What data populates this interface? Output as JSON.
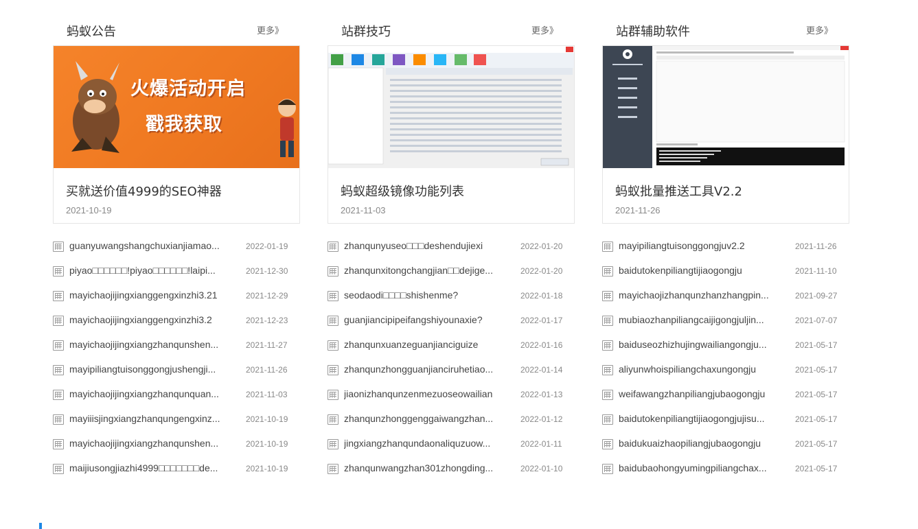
{
  "columns": [
    {
      "title": "蚂蚁公告",
      "more": "更多》",
      "feature": {
        "title": "买就送价值4999的SEO神器",
        "date": "2021-10-19",
        "image": {
          "line1": "火爆活动开启",
          "line2": "戳我获取"
        }
      },
      "items": [
        {
          "text": "guanyuwangshangchuxianjiamao...",
          "date": "2022-01-19"
        },
        {
          "text": "piyao□□□□□□!piyao□□□□□□!laipi...",
          "date": "2021-12-30"
        },
        {
          "text": "mayichaojijingxianggengxinzhi3.21",
          "date": "2021-12-29"
        },
        {
          "text": "mayichaojijingxianggengxinzhi3.2",
          "date": "2021-12-23"
        },
        {
          "text": "mayichaojijingxiangzhanqunshen...",
          "date": "2021-11-27"
        },
        {
          "text": "mayipiliangtuisonggongjushengji...",
          "date": "2021-11-26"
        },
        {
          "text": "mayichaojijingxiangzhanqunquan...",
          "date": "2021-11-03"
        },
        {
          "text": "mayiiisjingxiangzhanqungengxinz...",
          "date": "2021-10-19"
        },
        {
          "text": "mayichaojijingxiangzhanqunshen...",
          "date": "2021-10-19"
        },
        {
          "text": "maijiusongjiazhi4999□□□□□□□de...",
          "date": "2021-10-19"
        }
      ]
    },
    {
      "title": "站群技巧",
      "more": "更多》",
      "feature": {
        "title": "蚂蚁超级镜像功能列表",
        "date": "2021-11-03"
      },
      "items": [
        {
          "text": "zhanqunyuseo□□□deshendujiexi",
          "date": "2022-01-20"
        },
        {
          "text": "zhanqunxitongchangjian□□dejige...",
          "date": "2022-01-20"
        },
        {
          "text": "seodaodi□□□□shishenme?",
          "date": "2022-01-18"
        },
        {
          "text": "guanjiancipipeifangshiyounaxie?",
          "date": "2022-01-17"
        },
        {
          "text": "zhanqunxuanzeguanjianciguize",
          "date": "2022-01-16"
        },
        {
          "text": "zhanqunzhongguanjianciruhetiao...",
          "date": "2022-01-14"
        },
        {
          "text": "jiaonizhanqunzenmezuoseowailian",
          "date": "2022-01-13"
        },
        {
          "text": "zhanqunzhonggenggaiwangzhan...",
          "date": "2022-01-12"
        },
        {
          "text": "jingxiangzhanqundaonaliquzuow...",
          "date": "2022-01-11"
        },
        {
          "text": "zhanqunwangzhan301zhongding...",
          "date": "2022-01-10"
        }
      ]
    },
    {
      "title": "站群辅助软件",
      "more": "更多》",
      "feature": {
        "title": "蚂蚁批量推送工具V2.2",
        "date": "2021-11-26"
      },
      "items": [
        {
          "text": "mayipiliangtuisonggongjuv2.2",
          "date": "2021-11-26"
        },
        {
          "text": "baidutokenpiliangtijiaogongju",
          "date": "2021-11-10"
        },
        {
          "text": "mayichaojizhanqunzhanzhangpin...",
          "date": "2021-09-27"
        },
        {
          "text": "mubiaozhanpiliangcaijigongjuljin...",
          "date": "2021-07-07"
        },
        {
          "text": "baiduseozhizhujingwailiangongju...",
          "date": "2021-05-17"
        },
        {
          "text": "aliyunwhoispiliangchaxungongju",
          "date": "2021-05-17"
        },
        {
          "text": "weifawangzhanpiliangjubaogongju",
          "date": "2021-05-17"
        },
        {
          "text": "baidutokenpiliangtijiaogongjujisu...",
          "date": "2021-05-17"
        },
        {
          "text": "baidukuaizhaopiliangjubaogongju",
          "date": "2021-05-17"
        },
        {
          "text": "baidubaohongyumingpiliangchax...",
          "date": "2021-05-17"
        }
      ]
    }
  ],
  "colors": {
    "accent": "#1e88e5",
    "promo": "#f5832a",
    "border": "#e5e5e5",
    "date": "#888888"
  },
  "icons": {
    "list_item": "document-grid-icon"
  }
}
